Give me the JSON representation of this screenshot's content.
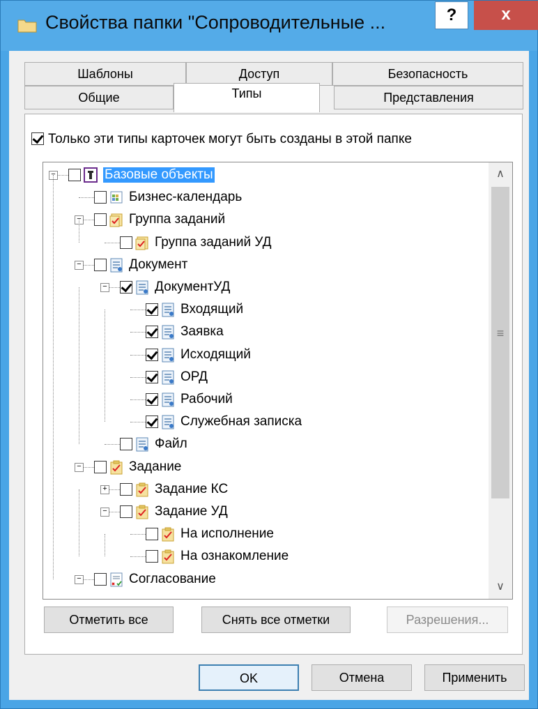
{
  "window": {
    "title": "Свойства папки \"Сопроводительные ...",
    "help_label": "?",
    "close_label": "x"
  },
  "tabs": {
    "row1": [
      {
        "label": "Шаблоны"
      },
      {
        "label": "Доступ"
      },
      {
        "label": "Безопасность"
      }
    ],
    "row2": [
      {
        "label": "Общие"
      },
      {
        "label": "Типы",
        "active": true
      },
      {
        "label": "Представления"
      }
    ]
  },
  "types_panel": {
    "only_these_label": "Только эти типы карточек могут быть созданы в этой папке",
    "only_these_checked": true,
    "tree": [
      {
        "label": "Базовые объекты",
        "checked": false,
        "selected": true,
        "icon": "tool-icon"
      },
      {
        "label": "Бизнес-календарь",
        "checked": false,
        "icon": "calendar-icon"
      },
      {
        "label": "Группа заданий",
        "checked": false,
        "icon": "task-group-icon"
      },
      {
        "label": "Группа заданий УД",
        "checked": false,
        "icon": "task-group-icon"
      },
      {
        "label": "Документ",
        "checked": false,
        "icon": "document-icon"
      },
      {
        "label": "ДокументУД",
        "checked": true,
        "icon": "document-icon"
      },
      {
        "label": "Входящий",
        "checked": true,
        "icon": "document-icon"
      },
      {
        "label": "Заявка",
        "checked": true,
        "icon": "document-icon"
      },
      {
        "label": "Исходящий",
        "checked": true,
        "icon": "document-icon"
      },
      {
        "label": "ОРД",
        "checked": true,
        "icon": "document-icon"
      },
      {
        "label": "Рабочий",
        "checked": true,
        "icon": "document-icon"
      },
      {
        "label": "Служебная записка",
        "checked": true,
        "icon": "document-icon"
      },
      {
        "label": "Файл",
        "checked": false,
        "icon": "document-icon"
      },
      {
        "label": "Задание",
        "checked": false,
        "icon": "task-icon"
      },
      {
        "label": "Задание КС",
        "checked": false,
        "icon": "task-icon"
      },
      {
        "label": "Задание УД",
        "checked": false,
        "icon": "task-icon"
      },
      {
        "label": "На исполнение",
        "checked": false,
        "icon": "task-icon"
      },
      {
        "label": "На ознакомление",
        "checked": false,
        "icon": "task-icon"
      },
      {
        "label": "Согласование",
        "checked": false,
        "icon": "approval-icon"
      }
    ],
    "select_all_label": "Отметить все",
    "clear_all_label": "Снять все отметки",
    "permissions_label": "Разрешения..."
  },
  "footer": {
    "ok_label": "OK",
    "cancel_label": "Отмена",
    "apply_label": "Применить"
  },
  "colors": {
    "titlebar": "#54abe8",
    "close_button": "#c7504a",
    "selection": "#3399ff"
  }
}
